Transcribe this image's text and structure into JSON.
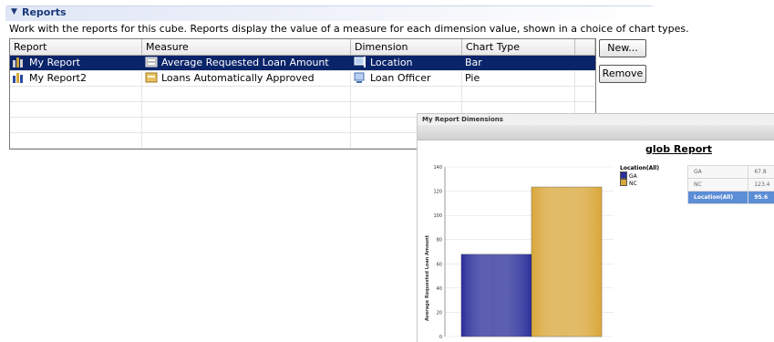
{
  "section": {
    "title": "Reports",
    "description": "Work with the reports for this cube. Reports display the value of a measure for each dimension value, shown in a choice of chart types."
  },
  "table": {
    "columns": [
      "Report",
      "Measure",
      "Dimension",
      "Chart Type"
    ],
    "rows": [
      {
        "report": "My Report",
        "measure": "Average Requested Loan Amount",
        "dimension": "Location",
        "chart_type": "Bar",
        "selected": true
      },
      {
        "report": "My Report2",
        "measure": "Loans Automatically Approved",
        "dimension": "Loan Officer",
        "chart_type": "Pie",
        "selected": false
      }
    ]
  },
  "buttons": {
    "new_label": "New...",
    "remove_label": "Remove"
  },
  "popup": {
    "window_title": "My Report Dimensions",
    "report_title": "glob Report",
    "legend_title": "Location(All)",
    "side_table": [
      {
        "label": "GA",
        "value": "67.8"
      },
      {
        "label": "NC",
        "value": "123.4"
      },
      {
        "label": "Location(All)",
        "value": "95.6"
      }
    ]
  },
  "chart_data": {
    "type": "bar",
    "categories": [
      "GA",
      "NC"
    ],
    "values": [
      67.8,
      123.4
    ],
    "colors": [
      "#2b2f9a",
      "#d9a73a"
    ],
    "ylabel": "Average Requested Loan Amount",
    "ylim": [
      0,
      140
    ],
    "yticks": [
      0,
      20,
      40,
      60,
      80,
      100,
      120,
      140
    ]
  }
}
